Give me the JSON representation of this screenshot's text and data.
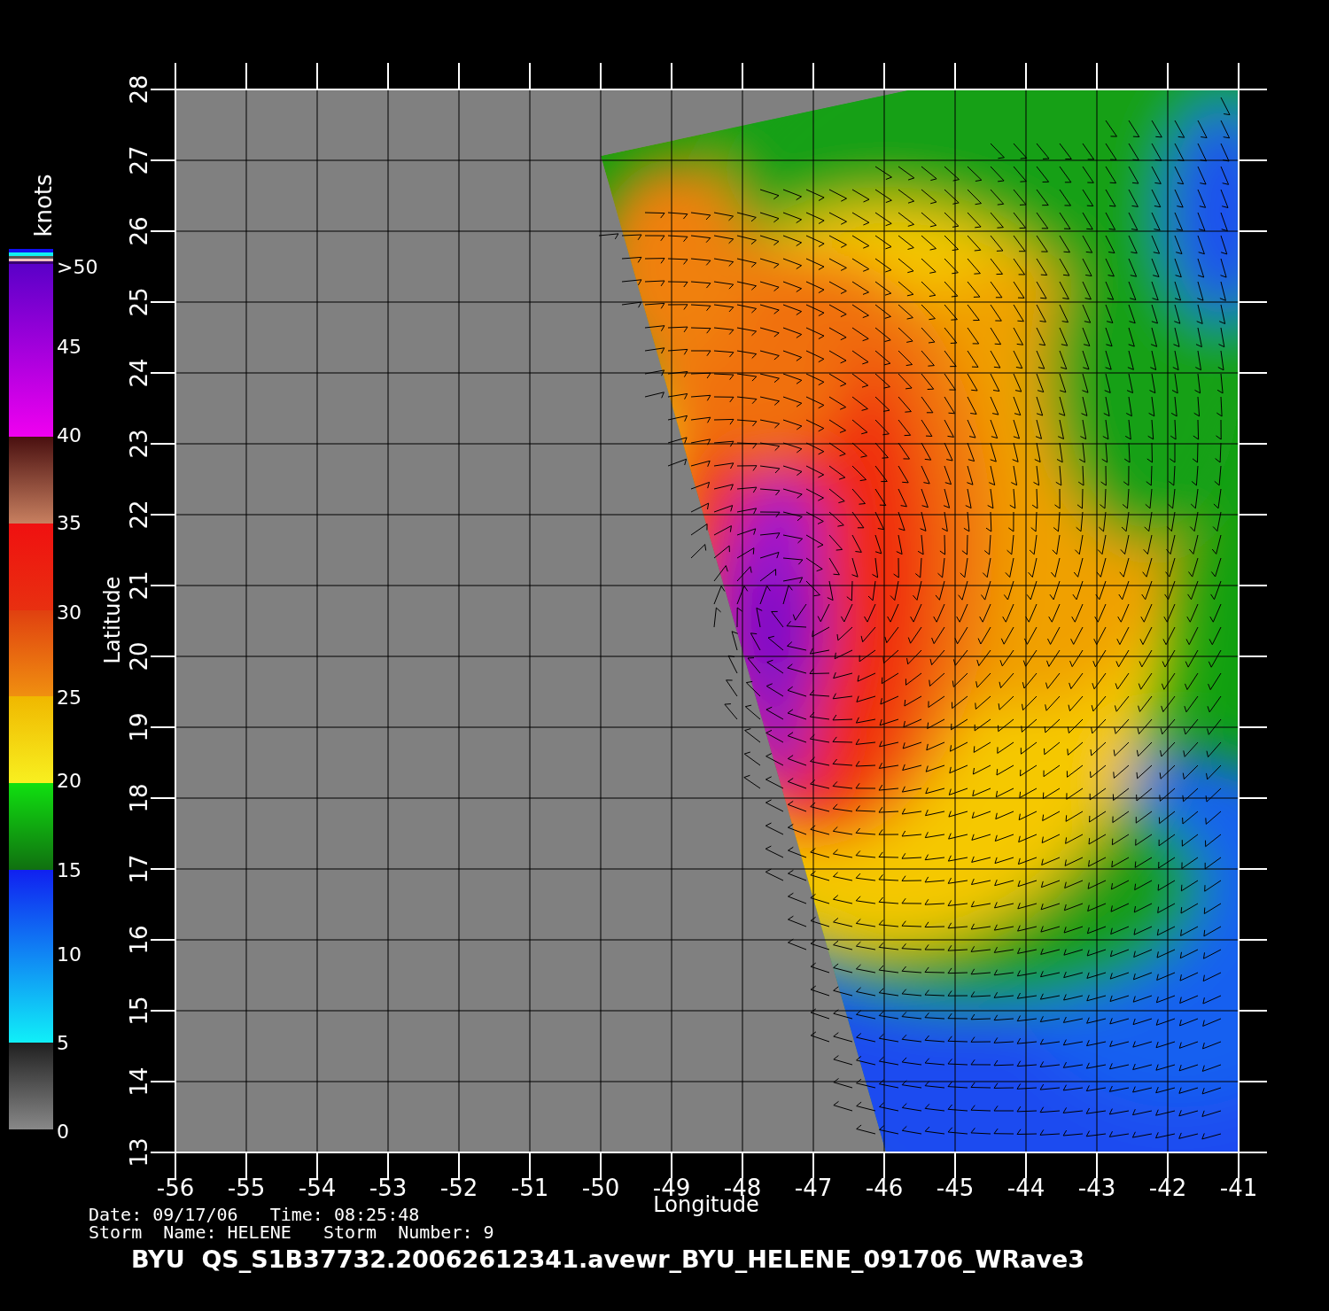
{
  "colorbar": {
    "title": "knots",
    "labels": [
      ">50",
      "45",
      "40",
      "35",
      "30",
      "25",
      "20",
      "15",
      "10",
      "5",
      "0"
    ]
  },
  "map": {
    "ylabel": "Latitude",
    "xlabel": "Longitude",
    "yticks": [
      "13",
      "14",
      "15",
      "16",
      "17",
      "18",
      "19",
      "20",
      "21",
      "22",
      "23",
      "24",
      "25",
      "26",
      "27",
      "28"
    ],
    "xticks": [
      "-56",
      "-55",
      "-54",
      "-53",
      "-52",
      "-51",
      "-50",
      "-49",
      "-48",
      "-47",
      "-46",
      "-45",
      "-44",
      "-43",
      "-42",
      "-41"
    ]
  },
  "info": [
    "Date: 09/17/06   Time: 08:25:48",
    "Storm  Name: HELENE   Storm  Number: 9"
  ],
  "title": "BYU  QS_S1B37732.20062612341.avewr_BYU_HELENE_091706_WRave3"
}
